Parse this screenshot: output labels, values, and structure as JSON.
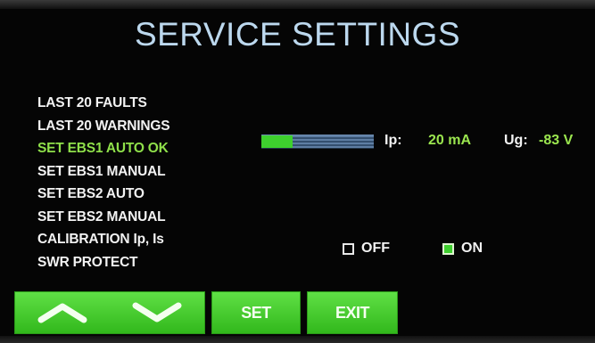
{
  "screen": {
    "title": "SERVICE SETTINGS"
  },
  "menu": {
    "items": [
      {
        "label": "LAST 20 FAULTS",
        "active": false
      },
      {
        "label": "LAST 20 WARNINGS",
        "active": false
      },
      {
        "label": "SET EBS1 AUTO OK",
        "active": true
      },
      {
        "label": "SET EBS1 MANUAL",
        "active": false
      },
      {
        "label": "SET EBS2 AUTO",
        "active": false
      },
      {
        "label": "SET EBS2 MANUAL",
        "active": false
      },
      {
        "label": "CALIBRATION Ip, Is",
        "active": false
      },
      {
        "label": "SWR PROTECT",
        "active": false
      }
    ]
  },
  "readouts": {
    "ip_bar_level": 0.28,
    "ip_label": "Ip:",
    "ip_value": "20 mA",
    "ug_label": "Ug:",
    "ug_value": "-83 V"
  },
  "swr_protect": {
    "off_label": "OFF",
    "on_label": "ON",
    "selected": "ON"
  },
  "buttons": {
    "set_label": "SET",
    "exit_label": "EXIT"
  },
  "icons": {
    "up": "chevron-up-icon",
    "down": "chevron-down-icon"
  },
  "colors": {
    "title": "#bcd8ee",
    "active_item": "#8fe04a",
    "button_green": "#3ecf2e",
    "bar_blue": "#3c5a7e"
  }
}
